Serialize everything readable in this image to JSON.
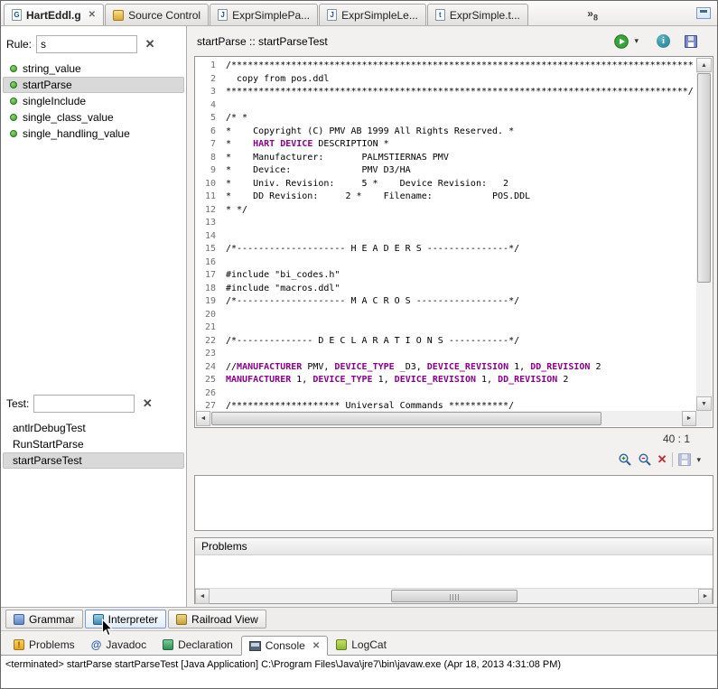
{
  "editor_tabs": {
    "tabs": [
      {
        "label": "HartEddl.g",
        "icon_glyph": "G"
      },
      {
        "label": "Source Control",
        "icon_glyph": ""
      },
      {
        "label": "ExprSimplePa...",
        "icon_glyph": "J"
      },
      {
        "label": "ExprSimpleLe...",
        "icon_glyph": "J"
      },
      {
        "label": "ExprSimple.t...",
        "icon_glyph": "t"
      }
    ],
    "overflow_chevron": "»",
    "overflow_count": "8"
  },
  "rule_panel": {
    "label": "Rule:",
    "filter_value": "s",
    "clear_glyph": "✕",
    "items": [
      "string_value",
      "startParse",
      "singleInclude",
      "single_class_value",
      "single_handling_value"
    ],
    "selected": "startParse"
  },
  "test_panel": {
    "label": "Test:",
    "filter_value": "",
    "clear_glyph": "✕",
    "items": [
      "antlrDebugTest",
      "RunStartParse",
      "startParseTest"
    ],
    "selected": "startParseTest"
  },
  "interpreter": {
    "header_title": "startParse :: startParseTest",
    "cursor_position": "40 : 1",
    "problems_label": "Problems",
    "info_glyph": "i",
    "clear_glyph": "✕"
  },
  "code": {
    "keyword_color": "#8A008A",
    "lines": [
      [
        {
          "t": "/*************************************************************************************"
        }
      ],
      [
        {
          "t": "  copy from pos.ddl"
        }
      ],
      [
        {
          "t": "*************************************************************************************/"
        }
      ],
      [],
      [
        {
          "t": "/* *"
        }
      ],
      [
        {
          "t": "*    Copyright (C) PMV AB 1999 All Rights Reserved. *"
        }
      ],
      [
        {
          "t": "*    "
        },
        {
          "t": "HART DEVICE",
          "k": 1
        },
        {
          "t": " DESCRIPTION *"
        }
      ],
      [
        {
          "t": "*    Manufacturer:       PALMSTIERNAS PMV"
        }
      ],
      [
        {
          "t": "*    Device:             PMV D3/HA"
        }
      ],
      [
        {
          "t": "*    Univ. Revision:     5 *    Device Revision:   2"
        }
      ],
      [
        {
          "t": "*    DD Revision:     2 *    Filename:           POS.DDL"
        }
      ],
      [
        {
          "t": "* */"
        }
      ],
      [],
      [],
      [
        {
          "t": "/*-------------------- H E A D E R S ---------------*/"
        }
      ],
      [],
      [
        {
          "t": "#include \"bi_codes.h\""
        }
      ],
      [
        {
          "t": "#include \"macros.ddl\""
        }
      ],
      [
        {
          "t": "/*-------------------- M A C R O S -----------------*/"
        }
      ],
      [],
      [],
      [
        {
          "t": "/*-------------- D E C L A R A T I O N S -----------*/"
        }
      ],
      [],
      [
        {
          "t": "//"
        },
        {
          "t": "MANUFACTURER",
          "k": 1
        },
        {
          "t": " PMV, "
        },
        {
          "t": "DEVICE_TYPE",
          "k": 1
        },
        {
          "t": " _D3, "
        },
        {
          "t": "DEVICE_REVISION",
          "k": 1
        },
        {
          "t": " 1, "
        },
        {
          "t": "DD_REVISION",
          "k": 1
        },
        {
          "t": " 2"
        }
      ],
      [
        {
          "t": "MANUFACTURER",
          "k": 1
        },
        {
          "t": " 1, "
        },
        {
          "t": "DEVICE_TYPE",
          "k": 1
        },
        {
          "t": " 1, "
        },
        {
          "t": "DEVICE_REVISION",
          "k": 1
        },
        {
          "t": " 1, "
        },
        {
          "t": "DD_REVISION",
          "k": 1
        },
        {
          "t": " 2"
        }
      ],
      [],
      [
        {
          "t": "/******************** Universal Commands ***********/"
        }
      ]
    ]
  },
  "view_tabs": {
    "tabs": [
      {
        "label": "Grammar"
      },
      {
        "label": "Interpreter"
      },
      {
        "label": "Railroad View"
      }
    ]
  },
  "console_area": {
    "tabs": [
      {
        "label": "Problems",
        "icon_glyph": "!"
      },
      {
        "label": "Javadoc",
        "icon_glyph": "@"
      },
      {
        "label": "Declaration"
      },
      {
        "label": "Console"
      },
      {
        "label": "LogCat"
      }
    ],
    "status_line": "<terminated> startParse startParseTest [Java Application] C:\\Program Files\\Java\\jre7\\bin\\javaw.exe (Apr 18, 2013 4:31:08 PM)"
  },
  "glyphs": {
    "close": "✕",
    "dropdown": "▾",
    "scroll_up": "▲",
    "scroll_down": "▼",
    "scroll_left": "◄",
    "scroll_right": "►"
  }
}
